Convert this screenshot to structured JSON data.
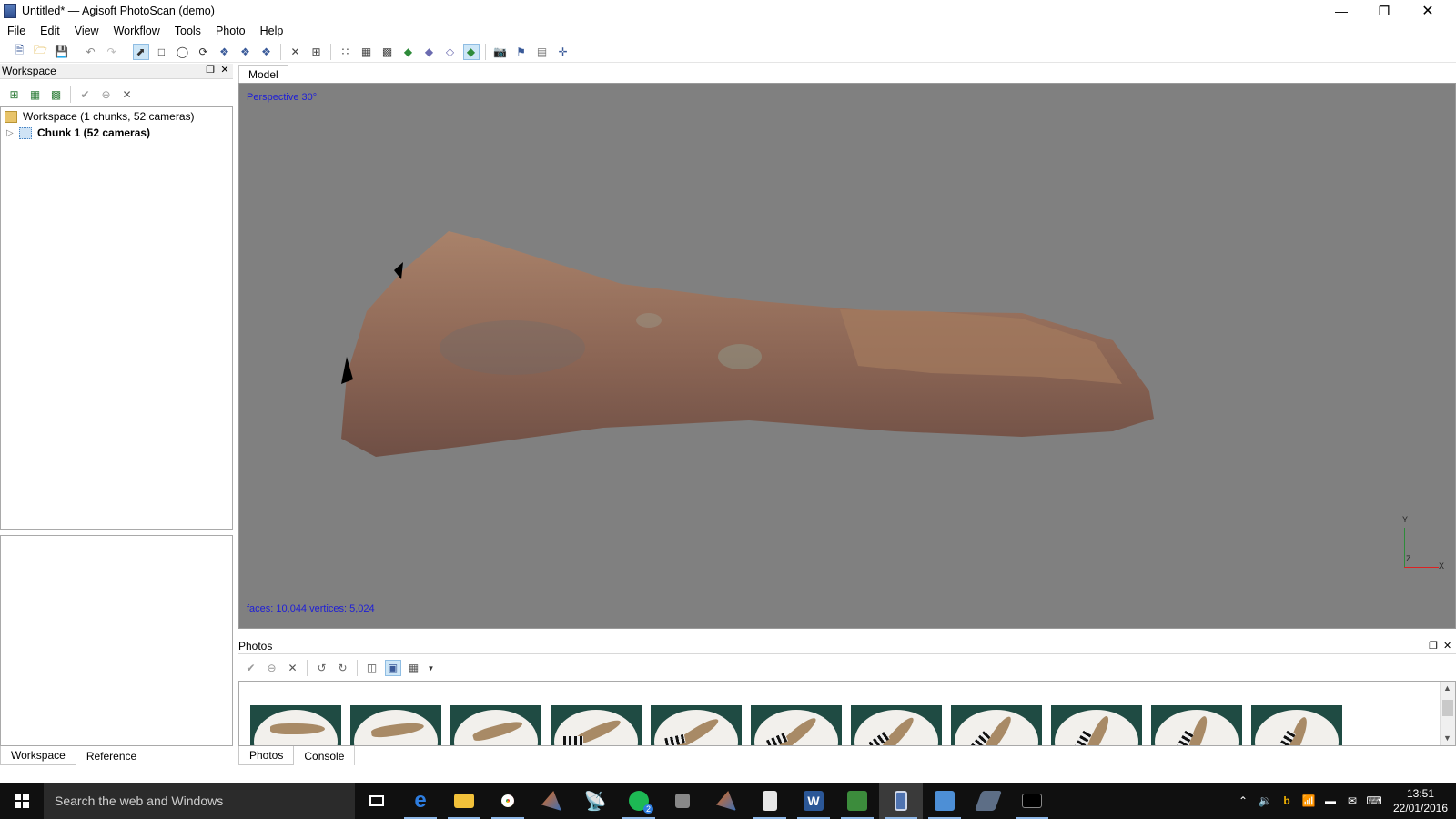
{
  "window": {
    "title": "Untitled* — Agisoft PhotoScan (demo)"
  },
  "menu": [
    "File",
    "Edit",
    "View",
    "Workflow",
    "Tools",
    "Photo",
    "Help"
  ],
  "workspace": {
    "panel_title": "Workspace",
    "root_label": "Workspace (1 chunks, 52 cameras)",
    "chunk_label": "Chunk 1 (52 cameras)",
    "tabs": [
      "Workspace",
      "Reference"
    ]
  },
  "model": {
    "tab_label": "Model",
    "projection": "Perspective 30°",
    "stats": "faces: 10,044 vertices: 5,024",
    "axis_labels": {
      "x": "X",
      "y": "Y",
      "z": "Z"
    }
  },
  "photos": {
    "panel_title": "Photos",
    "tabs": [
      "Photos",
      "Console"
    ],
    "thumbnail_count": 11
  },
  "taskbar": {
    "search_placeholder": "Search the web and Windows",
    "time": "13:51",
    "date": "22/01/2016",
    "spotify_badge": "2"
  },
  "colors": {
    "viewport_bg": "#808080",
    "overlay_text": "#1d1dd8",
    "taskbar_bg": "#101010"
  }
}
